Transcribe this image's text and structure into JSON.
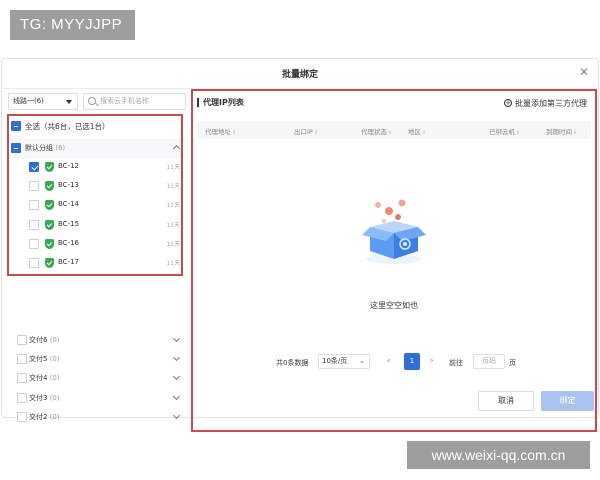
{
  "watermarks": {
    "top": "TG: MYYJJPP",
    "bottom": "www.weixi-qq.com.cn"
  },
  "dialog": {
    "title": "批量绑定",
    "close_icon": "close-icon"
  },
  "left": {
    "line_select": "线路一(6)",
    "search_placeholder": "搜索云手机名称",
    "select_all": "全选（共6台，已选1台）",
    "group": {
      "label": "默认分组",
      "count": "(6)"
    },
    "devices": [
      {
        "name": "BC-12",
        "days": "11天",
        "checked": true
      },
      {
        "name": "BC-13",
        "days": "11天",
        "checked": false
      },
      {
        "name": "BC-14",
        "days": "11天",
        "checked": false
      },
      {
        "name": "BC-15",
        "days": "11天",
        "checked": false
      },
      {
        "name": "BC-16",
        "days": "11天",
        "checked": false
      },
      {
        "name": "BC-17",
        "days": "11天",
        "checked": false
      }
    ],
    "groups": [
      {
        "label": "交付6",
        "count": "(0)"
      },
      {
        "label": "交付5",
        "count": "(0)"
      },
      {
        "label": "交付4",
        "count": "(0)"
      },
      {
        "label": "交付3",
        "count": "(0)"
      },
      {
        "label": "交付2",
        "count": "(0)"
      }
    ]
  },
  "right": {
    "title": "代理IP列表",
    "add_button": "批量添加第三方代理",
    "columns": [
      "代理地址",
      "出口IP",
      "代理状态",
      "地区",
      "已绑云机",
      "到期时间"
    ],
    "empty_text": "这里空空如也",
    "pagination": {
      "total": "共0条数据",
      "page_size": "10条/页",
      "current_page": "1",
      "goto_label": "前往",
      "goto_placeholder": "页码",
      "page_unit": "页"
    }
  },
  "footer": {
    "cancel": "取消",
    "confirm": "绑定"
  },
  "colors": {
    "accent": "#2f6fd6",
    "highlight_border": "#c94a4a",
    "disabled_primary": "#a9c3ec",
    "shield": "#3aa757"
  }
}
